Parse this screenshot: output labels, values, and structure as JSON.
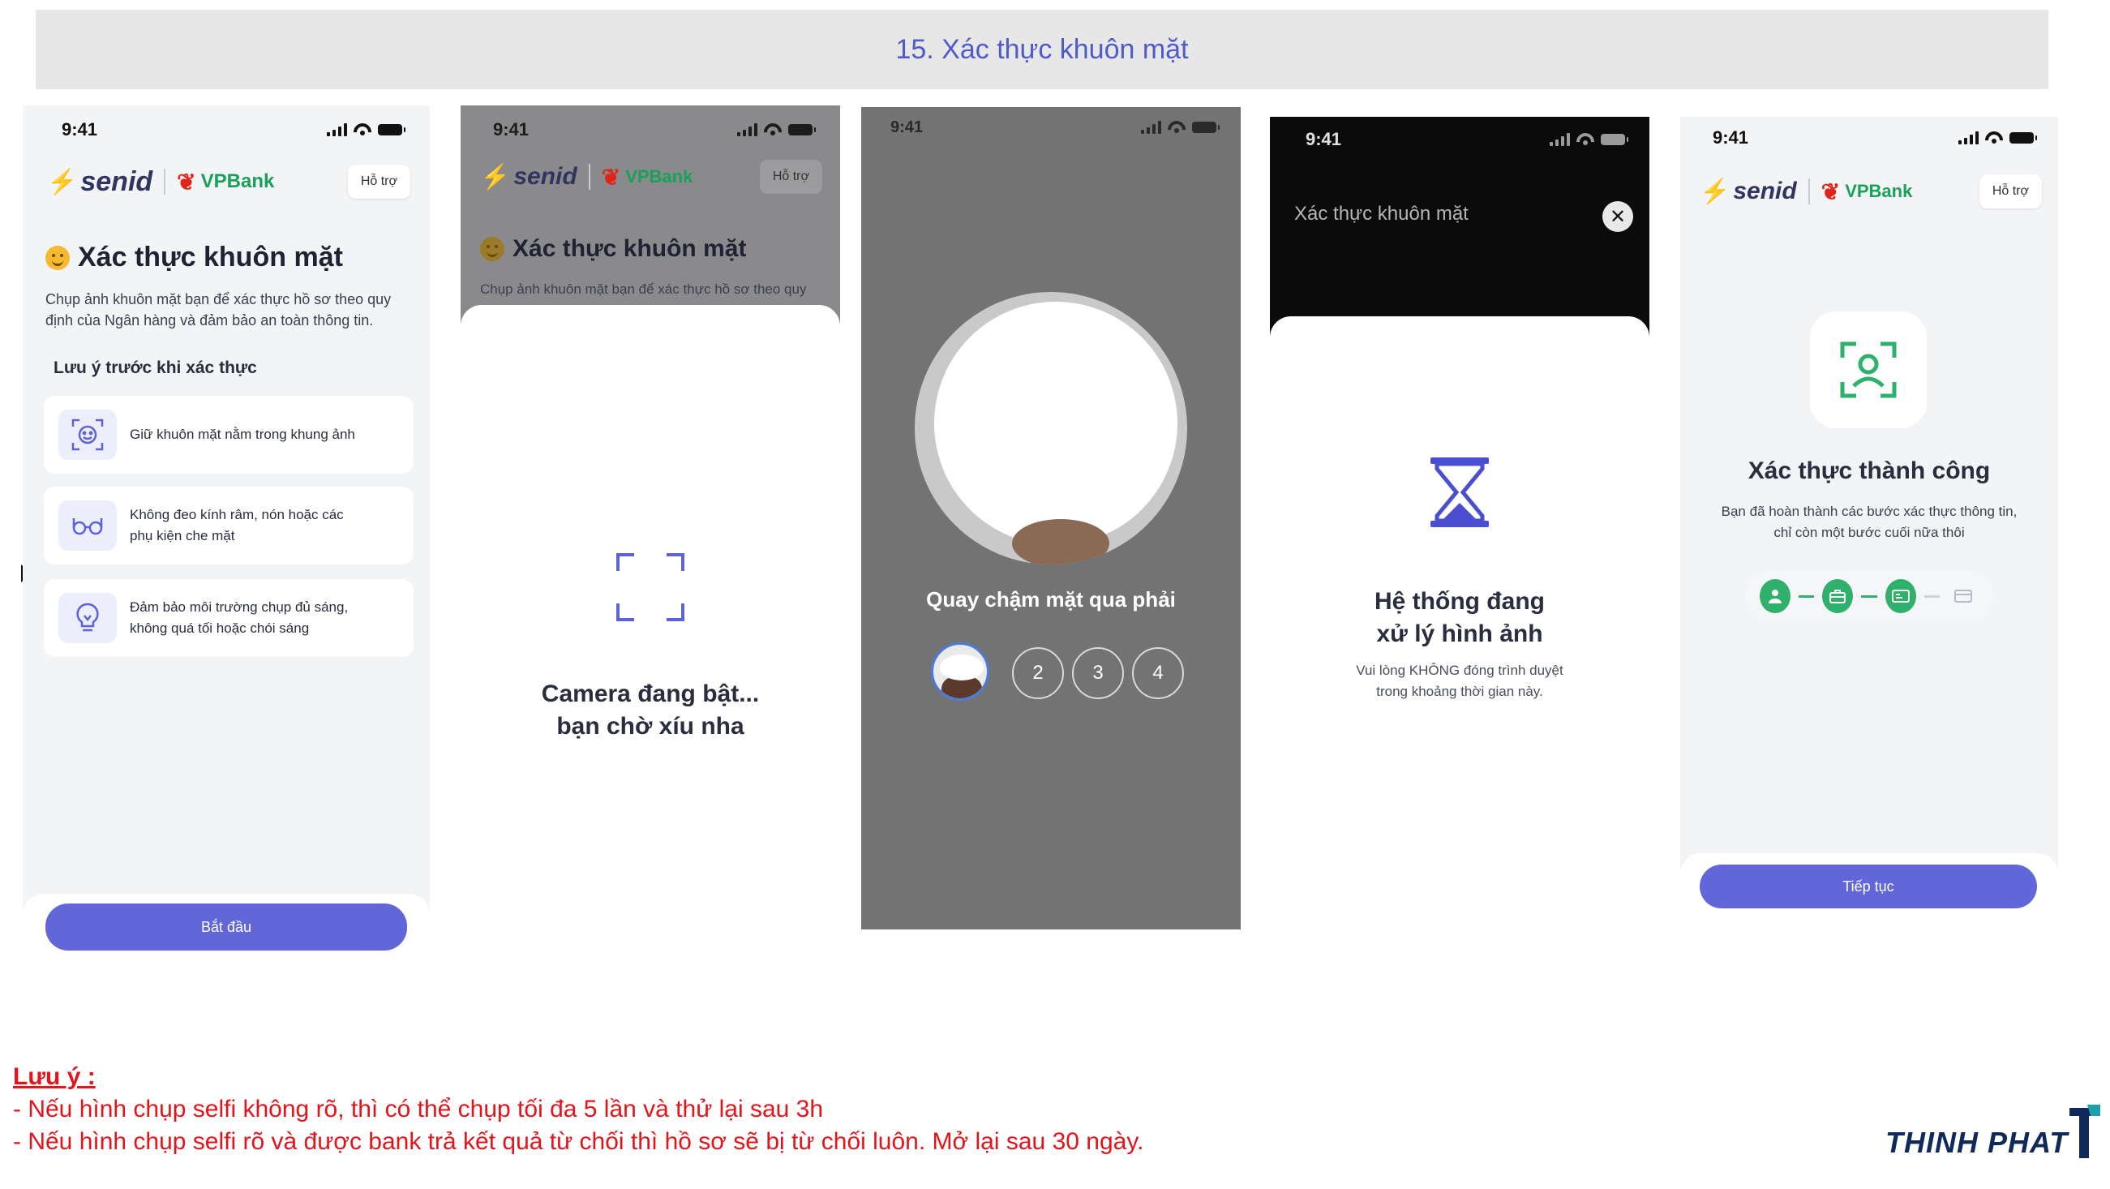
{
  "page_title": "15. Xác thực khuôn mặt",
  "status_time": "9:41",
  "brand": {
    "senid": "senid",
    "vpbank": "VPBank",
    "help": "Hỗ trợ"
  },
  "screen1": {
    "title": "Xác thực khuôn mặt",
    "desc_line1": "Chụp ảnh khuôn mặt bạn để xác thực hồ sơ theo quy",
    "desc_line2": "định của Ngân hàng và đảm bảo an toàn thông tin.",
    "section": "Lưu ý trước khi xác thực",
    "tips": [
      {
        "line1": "Giữ khuôn mặt nằm trong khung ảnh",
        "line2": ""
      },
      {
        "line1": "Không đeo kính râm, nón hoặc các",
        "line2": "phụ kiện che mặt"
      },
      {
        "line1": "Đảm bảo môi trường chụp đủ sáng,",
        "line2": "không quá tối hoặc chói sáng"
      }
    ],
    "button": "Bắt đầu"
  },
  "screen2": {
    "title": "Xác thực khuôn mặt",
    "desc_line1": "Chụp ảnh khuôn mặt bạn để xác thực hồ sơ theo quy",
    "msg_line1": "Camera đang bật...",
    "msg_line2": "bạn chờ xíu nha"
  },
  "screen3": {
    "instruction": "Quay chậm mặt qua  phải",
    "steps": [
      "2",
      "3",
      "4"
    ]
  },
  "screen4": {
    "header": "Xác thực khuôn mặt",
    "title_line1": "Hệ thống đang",
    "title_line2": "xử lý hình ảnh",
    "desc_line1": "Vui lòng KHÔNG đóng trình duyệt",
    "desc_line2": "trong khoảng thời gian này."
  },
  "screen5": {
    "title": "Xác thực thành công",
    "desc_line1": "Bạn đã hoàn thành các bước xác thực thông tin,",
    "desc_line2": "chỉ còn một bước cuối nữa thôi",
    "button": "Tiếp tục"
  },
  "notes": {
    "heading": "Lưu ý :",
    "line1": "- Nếu hình chụp selfi không rõ, thì có thể chụp tối đa 5 lần và thử lại sau 3h",
    "line2": "- Nếu hình chụp selfi rõ và được bank trả kết quả từ chối thì hồ sơ sẽ bị từ chối luôn. Mở lại sau 30 ngày."
  },
  "company": "THINH PHAT",
  "colors": {
    "accent": "#6166d8",
    "success": "#2fb06b",
    "note": "#e4141b",
    "title": "#4f5bc9"
  }
}
